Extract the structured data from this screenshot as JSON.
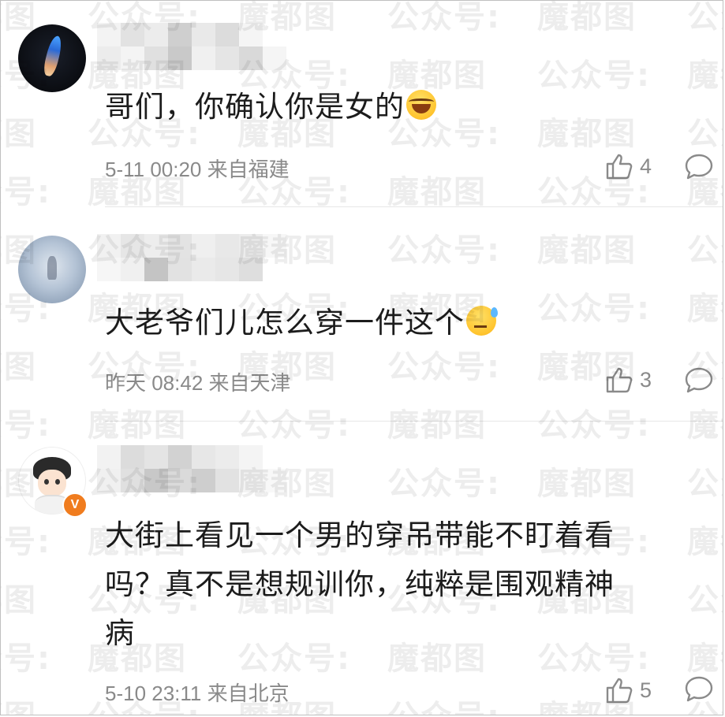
{
  "watermark": {
    "text_a": "魔都图",
    "text_b": "公众号:"
  },
  "comments": [
    {
      "text": "哥们，你确认你是女的",
      "emoji": "laughing-tears-emoji",
      "time": "5-11 00:20",
      "location": "来自福建",
      "likes": "4"
    },
    {
      "text": "大老爷们儿怎么穿一件这个",
      "emoji": "sweat-face-emoji",
      "time": "昨天 08:42",
      "location": "来自天津",
      "likes": "3"
    },
    {
      "text_line1": "大街上看见一个男的穿吊带能不盯着看",
      "text_line2": "吗？真不是想规训你，纯粹是围观精神",
      "text_line3": "病",
      "time": "5-10 23:11",
      "location": "来自北京",
      "likes": "5",
      "verified_badge": "V"
    }
  ],
  "icons": {
    "like": "thumbs-up-icon",
    "reply": "comment-bubble-icon"
  },
  "colors": {
    "meta_text": "#8a8a8a",
    "badge": "#f07c1e"
  }
}
